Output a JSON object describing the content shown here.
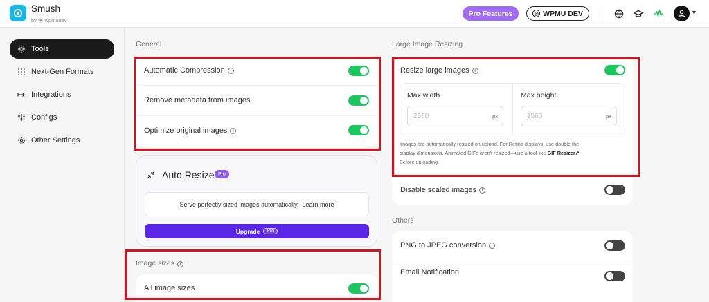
{
  "header": {
    "app_title": "Smush",
    "app_subtitle": "by ⦿ wpmudev",
    "pro_features": "Pro Features",
    "wpmu_dev": "WPMU DEV",
    "icons": [
      "globe-icon",
      "graduation-cap-icon",
      "activity-icon",
      "avatar",
      "chevron-down-icon"
    ]
  },
  "sidebar": {
    "items": [
      {
        "label": "Tools",
        "icon": "gear-icon",
        "active": true
      },
      {
        "label": "Next-Gen Formats",
        "icon": "grid-dots-icon",
        "active": false
      },
      {
        "label": "Integrations",
        "icon": "integration-arrow-icon",
        "active": false
      },
      {
        "label": "Configs",
        "icon": "sliders-icon",
        "active": false
      },
      {
        "label": "Other Settings",
        "icon": "settings-icon",
        "active": false
      }
    ]
  },
  "general": {
    "heading": "General",
    "rows": [
      {
        "label": "Automatic Compression",
        "info": true,
        "enabled": true
      },
      {
        "label": "Remove metadata from images",
        "info": false,
        "enabled": true
      },
      {
        "label": "Optimize original images",
        "info": true,
        "enabled": true
      }
    ]
  },
  "auto_resize": {
    "title": "Auto Resize",
    "badge": "Pro",
    "description": "Serve perfectly sized images automatically.",
    "learn_more": "Learn more",
    "upgrade": "Upgrade",
    "upgrade_badge": "Pro"
  },
  "image_sizes": {
    "heading": "Image sizes",
    "row_label": "All image sizes",
    "enabled": true
  },
  "large_resizing": {
    "heading": "Large Image Resizing",
    "resize_label": "Resize large images",
    "resize_enabled": true,
    "max_width_label": "Max width",
    "max_width_value": "2560",
    "max_height_label": "Max height",
    "max_height_value": "2560",
    "unit": "px",
    "help_1": "Images are automatically resized on upload. For Retina displays, use double the",
    "help_2": "display dimensions. Animated GIFs aren't resized—use a tool like",
    "help_link": "GIF Resizer",
    "help_3": "Before uploading.",
    "disable_scaled_label": "Disable scaled images",
    "disable_scaled_enabled": false
  },
  "others": {
    "heading": "Others",
    "rows": [
      {
        "label": "PNG to JPEG conversion",
        "info": true,
        "enabled": false
      },
      {
        "label": "Email Notification",
        "info": false,
        "enabled": false
      }
    ]
  },
  "colors": {
    "toggle_on": "#1cc760",
    "toggle_off": "#444444",
    "pro_purple": "#a06bf2",
    "upgrade_purple": "#5a26e8",
    "highlight_red": "#d8121c"
  }
}
